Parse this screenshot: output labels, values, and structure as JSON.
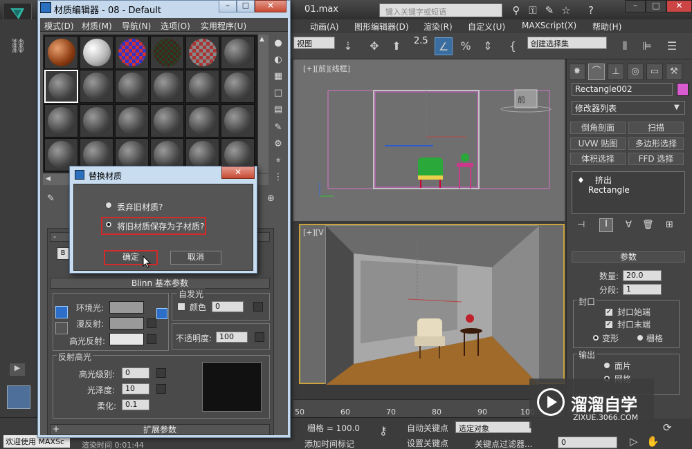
{
  "app": {
    "file_title": "01.max",
    "search_placeholder": "键入关键字或短语",
    "menu": [
      "动画(A)",
      "图形编辑器(D)",
      "渲染(R)",
      "自定义(U)",
      "MAXScript(X)",
      "帮助(H)"
    ],
    "view_dropdown": "视图",
    "snap_value": "2.5",
    "selection_set_placeholder": "创建选择集"
  },
  "viewports": {
    "front_label": "[+][前][线框]",
    "persp_label": "[+][V",
    "front_cube_label": "前"
  },
  "timeline": {
    "ticks": [
      "50",
      "60",
      "70",
      "80",
      "90",
      "100"
    ]
  },
  "status": {
    "welcome": "欢迎使用 MAXSc",
    "render_time": "渲染时间  0:01:44",
    "grid": "栅格 = 100.0",
    "add_time_tag": "添加时间标记",
    "auto_key": "自动关键点",
    "set_key": "设置关键点",
    "selected_object": "选定对象",
    "key_filters": "关键点过滤器...",
    "frame_value": "0"
  },
  "command_panel": {
    "object_name": "Rectangle002",
    "object_color": "#d85bd0",
    "modifier_list": "修改器列表",
    "modifier_buttons": [
      "倒角剖面",
      "扫描",
      "UVW 贴图",
      "多边形选择",
      "体积选择",
      "FFD 选择"
    ],
    "stack": [
      "挤出",
      "Rectangle"
    ],
    "params_title": "参数",
    "amount_label": "数量:",
    "amount_value": "20.0",
    "segments_label": "分段:",
    "segments_value": "1",
    "cap_title": "封口",
    "cap_start": "封口始端",
    "cap_end": "封口末端",
    "morph": "变形",
    "grid": "栅格",
    "output_title": "输出",
    "patch": "面片",
    "mesh": "网格"
  },
  "watermark": {
    "title": "溜溜自学",
    "url": "ZIXUE.3066.COM"
  },
  "material_editor": {
    "title": "材质编辑器 - 08 - Default",
    "menu": [
      "模式(D)",
      "材质(M)",
      "导航(N)",
      "选项(O)",
      "实用程序(U)"
    ],
    "blinn_title": "Blinn 基本参数",
    "self_illum_title": "自发光",
    "color_label": "颜色",
    "color_value": "0",
    "ambient_label": "环境光:",
    "diffuse_label": "漫反射:",
    "specular_label": "高光反射:",
    "opacity_label": "不透明度:",
    "opacity_value": "100",
    "spec_hl_title": "反射高光",
    "spec_level_label": "高光级别:",
    "spec_level_value": "0",
    "gloss_label": "光泽度:",
    "gloss_value": "10",
    "soften_label": "柔化:",
    "soften_value": "0.1",
    "extended_title": "扩展参数",
    "button_b": "B"
  },
  "dialog": {
    "title": "替换材质",
    "option_discard": "丢弃旧材质?",
    "option_keep": "将旧材质保存为子材质?",
    "selected_option": "option_keep",
    "ok": "确定",
    "cancel": "取消"
  }
}
